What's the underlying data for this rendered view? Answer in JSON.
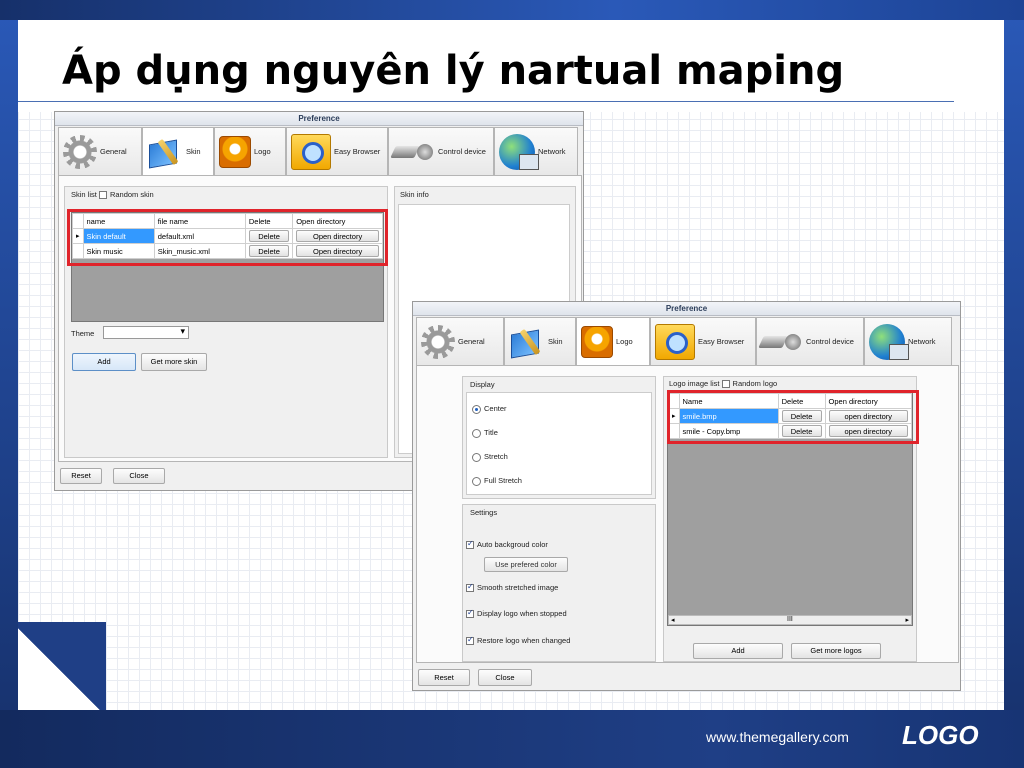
{
  "slide": {
    "title": "Áp dụng nguyên lý nartual maping",
    "footer_url": "www.themegallery.com",
    "footer_logo": "LOGO"
  },
  "colors": {
    "brand_blue": "#1f3f86",
    "highlight_red": "#e0242b",
    "selection": "#3399ff"
  },
  "window1": {
    "title": "Preference",
    "tabs": [
      {
        "label": "General",
        "icon": "gear-icon"
      },
      {
        "label": "Skin",
        "icon": "skin-icon",
        "active": true
      },
      {
        "label": "Logo",
        "icon": "gom-logo-icon"
      },
      {
        "label": "Easy Browser",
        "icon": "folder-search-icon"
      },
      {
        "label": "Control device",
        "icon": "remote-control-icon"
      },
      {
        "label": "Network",
        "icon": "network-globe-icon"
      }
    ],
    "skin_list_label": "Skin list",
    "random_skin_label": "Random skin",
    "skin_info_label": "Skin info",
    "columns": [
      "name",
      "file name",
      "Delete",
      "Open directory"
    ],
    "rows": [
      {
        "name": "Skin default",
        "file": "default.xml",
        "delete": "Delete",
        "open": "Open directory",
        "selected": true
      },
      {
        "name": "Skin music",
        "file": "Skin_music.xml",
        "delete": "Delete",
        "open": "Open directory",
        "selected": false
      }
    ],
    "theme_label": "Theme",
    "theme_value": "",
    "add_label": "Add",
    "get_more_label": "Get more skin",
    "reset_label": "Reset",
    "close_label": "Close"
  },
  "window2": {
    "title": "Preference",
    "tabs": [
      {
        "label": "General",
        "icon": "gear-icon"
      },
      {
        "label": "Skin",
        "icon": "skin-icon"
      },
      {
        "label": "Logo",
        "icon": "gom-logo-icon",
        "active": true
      },
      {
        "label": "Easy Browser",
        "icon": "folder-search-icon"
      },
      {
        "label": "Control device",
        "icon": "remote-control-icon"
      },
      {
        "label": "Network",
        "icon": "network-globe-icon"
      }
    ],
    "display_label": "Display",
    "display_options": [
      {
        "label": "Center",
        "selected": true
      },
      {
        "label": "Title",
        "selected": false
      },
      {
        "label": "Stretch",
        "selected": false
      },
      {
        "label": "Full Stretch",
        "selected": false
      }
    ],
    "settings_label": "Settings",
    "auto_bg_label": "Auto backgroud color",
    "use_pref_color_label": "Use prefered color",
    "smooth_label": "Smooth stretched image",
    "display_stopped_label": "Display logo when stopped",
    "restore_label": "Restore logo when changed",
    "logo_list_label": "Logo image list",
    "random_logo_label": "Random logo",
    "columns": [
      "Name",
      "Delete",
      "Open directory"
    ],
    "rows": [
      {
        "name": "smile.bmp",
        "delete": "Delete",
        "open": "open directory",
        "selected": true
      },
      {
        "name": "smile - Copy.bmp",
        "delete": "Delete",
        "open": "open directory",
        "selected": false
      }
    ],
    "scroll_thumb": "III",
    "add_label": "Add",
    "get_more_label": "Get more logos",
    "reset_label": "Reset",
    "close_label": "Close"
  }
}
